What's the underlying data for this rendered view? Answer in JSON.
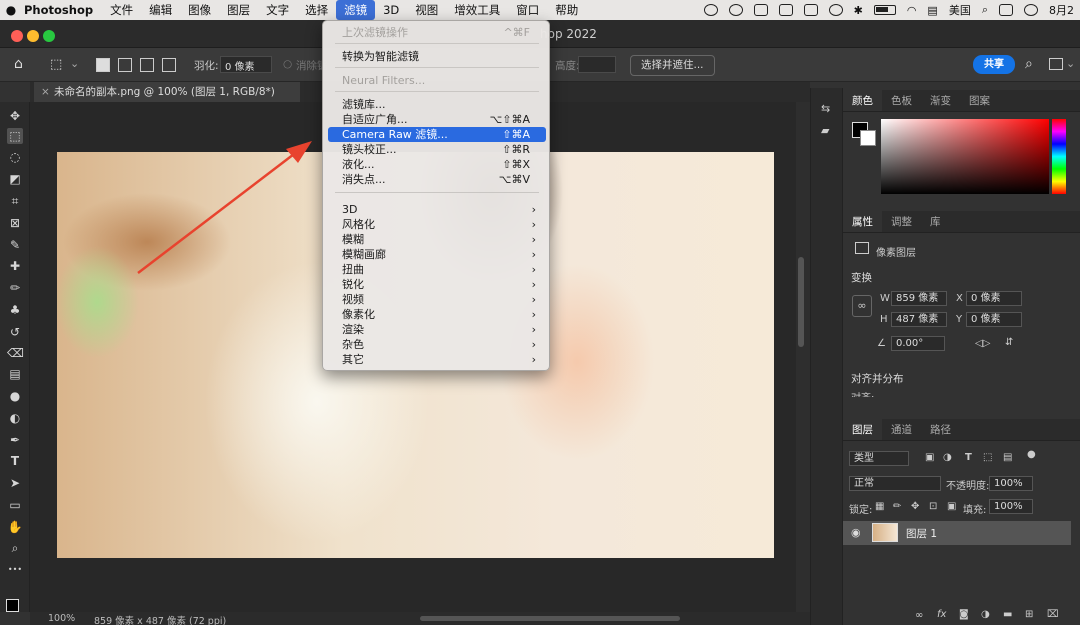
{
  "menubar": {
    "app": "Photoshop",
    "items": [
      "文件",
      "编辑",
      "图像",
      "图层",
      "文字",
      "选择",
      "滤镜",
      "3D",
      "视图",
      "增效工具",
      "窗口",
      "帮助"
    ],
    "active_index": 6,
    "status_country": "美国",
    "status_date": "8月2"
  },
  "window": {
    "title_fragment": "hop 2022"
  },
  "options_bar": {
    "feather_label": "羽化:",
    "feather_value": "0 像素",
    "antialias_label": "消除锯",
    "height_label": "高度:",
    "select_mask_label": "选择并遮住...",
    "share_label": "共享"
  },
  "document": {
    "tab_title": "未命名的副本.png @ 100% (图层 1, RGB/8*)",
    "close_glyph": "×",
    "zoom": "100%",
    "info": "859 像素 x 487 像素 (72 ppi)"
  },
  "filter_menu": {
    "items": [
      {
        "label": "上次滤镜操作",
        "shortcut": "^⌘F",
        "disabled": true
      },
      {
        "label": "转换为智能滤镜"
      },
      {
        "label": "Neural Filters...",
        "disabled": true
      },
      {
        "label": "滤镜库..."
      },
      {
        "label": "自适应广角...",
        "shortcut": "⌥⇧⌘A"
      },
      {
        "label": "Camera Raw 滤镜...",
        "shortcut": "⇧⌘A",
        "highlighted": true
      },
      {
        "label": "镜头校正...",
        "shortcut": "⇧⌘R"
      },
      {
        "label": "液化...",
        "shortcut": "⇧⌘X"
      },
      {
        "label": "消失点...",
        "shortcut": "⌥⌘V"
      },
      {
        "label": "3D",
        "submenu": true
      },
      {
        "label": "风格化",
        "submenu": true
      },
      {
        "label": "模糊",
        "submenu": true
      },
      {
        "label": "模糊画廊",
        "submenu": true
      },
      {
        "label": "扭曲",
        "submenu": true
      },
      {
        "label": "锐化",
        "submenu": true
      },
      {
        "label": "视频",
        "submenu": true
      },
      {
        "label": "像素化",
        "submenu": true
      },
      {
        "label": "渲染",
        "submenu": true
      },
      {
        "label": "杂色",
        "submenu": true
      },
      {
        "label": "其它",
        "submenu": true
      }
    ],
    "submenu_glyph": "›"
  },
  "color_panel": {
    "tabs": [
      "颜色",
      "色板",
      "渐变",
      "图案"
    ]
  },
  "properties_panel": {
    "tabs": [
      "属性",
      "调整",
      "库"
    ],
    "layer_type": "像素图层",
    "transform_title": "变换",
    "w_label": "W",
    "w_value": "859 像素",
    "h_label": "H",
    "h_value": "487 像素",
    "x_label": "X",
    "x_value": "0 像素",
    "y_label": "Y",
    "y_value": "0 像素",
    "angle_value": "0.00°",
    "align_title": "对齐并分布",
    "align_sub": "对齐:"
  },
  "layers_panel": {
    "tabs": [
      "图层",
      "通道",
      "路径"
    ],
    "filter_kind": "类型",
    "blend_mode": "正常",
    "opacity_label": "不透明度:",
    "opacity_value": "100%",
    "lock_label": "锁定:",
    "fill_label": "填充:",
    "fill_value": "100%",
    "layer_name": "图层 1",
    "fx_label": "fx"
  },
  "toolbar_glyphs": {
    "move": "✥",
    "marquee": "⬚",
    "lasso": "◌",
    "quick_select": "◩",
    "crop": "⌗",
    "frame": "⊠",
    "eyedropper": "✎",
    "healing": "✚",
    "brush": "✏",
    "stamp": "♣",
    "history": "↺",
    "eraser": "⌫",
    "gradient": "▤",
    "blur": "●",
    "dodge": "◐",
    "pen": "✒",
    "type": "T",
    "path_select": "➤",
    "rect": "▭",
    "hand": "✋",
    "zoom": "⌕",
    "more": "•••"
  },
  "colors": {
    "menu_highlight": "#2a6ae0",
    "share_button": "#1473e6",
    "arrow": "#e8432e",
    "traffic_red": "#fe5f57",
    "traffic_yellow": "#febc2e",
    "traffic_green": "#28c840"
  }
}
